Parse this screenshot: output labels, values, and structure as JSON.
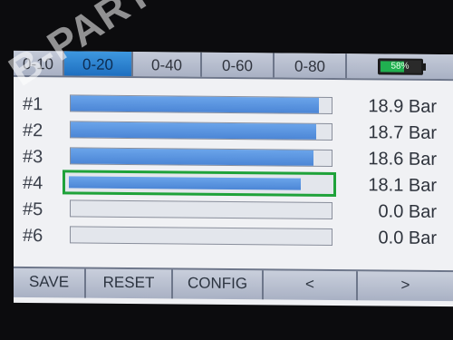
{
  "tabs": [
    {
      "label": "0-10",
      "active": false
    },
    {
      "label": "0-20",
      "active": true
    },
    {
      "label": "0-40",
      "active": false
    },
    {
      "label": "0-60",
      "active": false
    },
    {
      "label": "0-80",
      "active": false
    }
  ],
  "battery": {
    "text": "58%",
    "level": 0.58,
    "color": "#20b050"
  },
  "channels": [
    {
      "label": "#1",
      "value": "18.9 Bar",
      "fill": 0.95,
      "selected": false
    },
    {
      "label": "#2",
      "value": "18.7 Bar",
      "fill": 0.94,
      "selected": false
    },
    {
      "label": "#3",
      "value": "18.6 Bar",
      "fill": 0.93,
      "selected": false
    },
    {
      "label": "#4",
      "value": "18.1 Bar",
      "fill": 0.89,
      "selected": true
    },
    {
      "label": "#5",
      "value": "0.0 Bar",
      "fill": 0.0,
      "selected": false
    },
    {
      "label": "#6",
      "value": "0.0 Bar",
      "fill": 0.0,
      "selected": false
    }
  ],
  "buttons": [
    {
      "label": "SAVE",
      "name": "save-button"
    },
    {
      "label": "RESET",
      "name": "reset-button"
    },
    {
      "label": "CONFIG",
      "name": "config-button"
    },
    {
      "label": "<",
      "name": "prev-button"
    },
    {
      "label": ">",
      "name": "next-button"
    }
  ],
  "watermark": "B-PARTS",
  "colors": {
    "active_tab": "#1e6fc0",
    "bar_fill": "#5a94e0",
    "selected_outline": "#1fa23a"
  }
}
